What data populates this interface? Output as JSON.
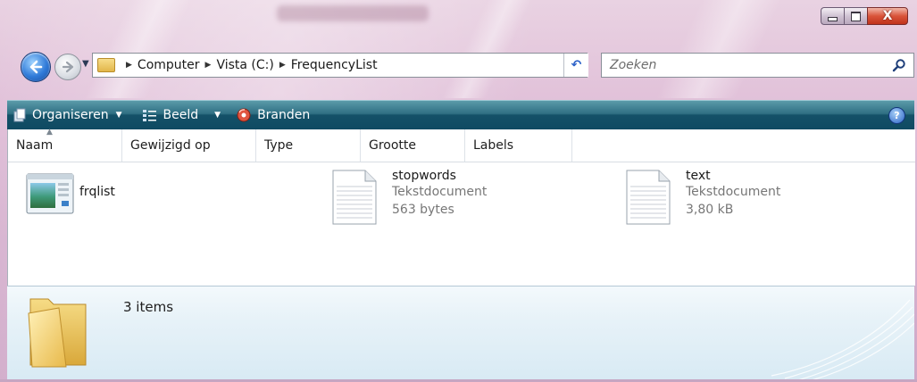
{
  "window": {
    "minimize_icon": "minimize-icon",
    "maximize_icon": "maximize-icon",
    "close_label": "X"
  },
  "nav": {
    "back_icon": "back-arrow-icon",
    "forward_icon": "forward-arrow-icon",
    "breadcrumb": [
      "Computer",
      "Vista (C:)",
      "FrequencyList"
    ],
    "refresh_label": "↶",
    "search_placeholder": "Zoeken"
  },
  "toolbar": {
    "organize_label": "Organiseren",
    "view_label": "Beeld",
    "burn_label": "Branden",
    "help_label": "?"
  },
  "columns": [
    "Naam",
    "Gewijzigd op",
    "Type",
    "Grootte",
    "Labels"
  ],
  "files": [
    {
      "name": "frqlist",
      "icon": "application-icon"
    },
    {
      "name": "stopwords",
      "type": "Tekstdocument",
      "size": "563 bytes",
      "icon": "text-document-icon"
    },
    {
      "name": "text",
      "type": "Tekstdocument",
      "size": "3,80 kB",
      "icon": "text-document-icon"
    }
  ],
  "details": {
    "count_text": "3 items",
    "icon": "folder-icon"
  },
  "colors": {
    "toolbar": "#0f4a62",
    "accent": "#2f7ad8",
    "close": "#c0331b"
  }
}
